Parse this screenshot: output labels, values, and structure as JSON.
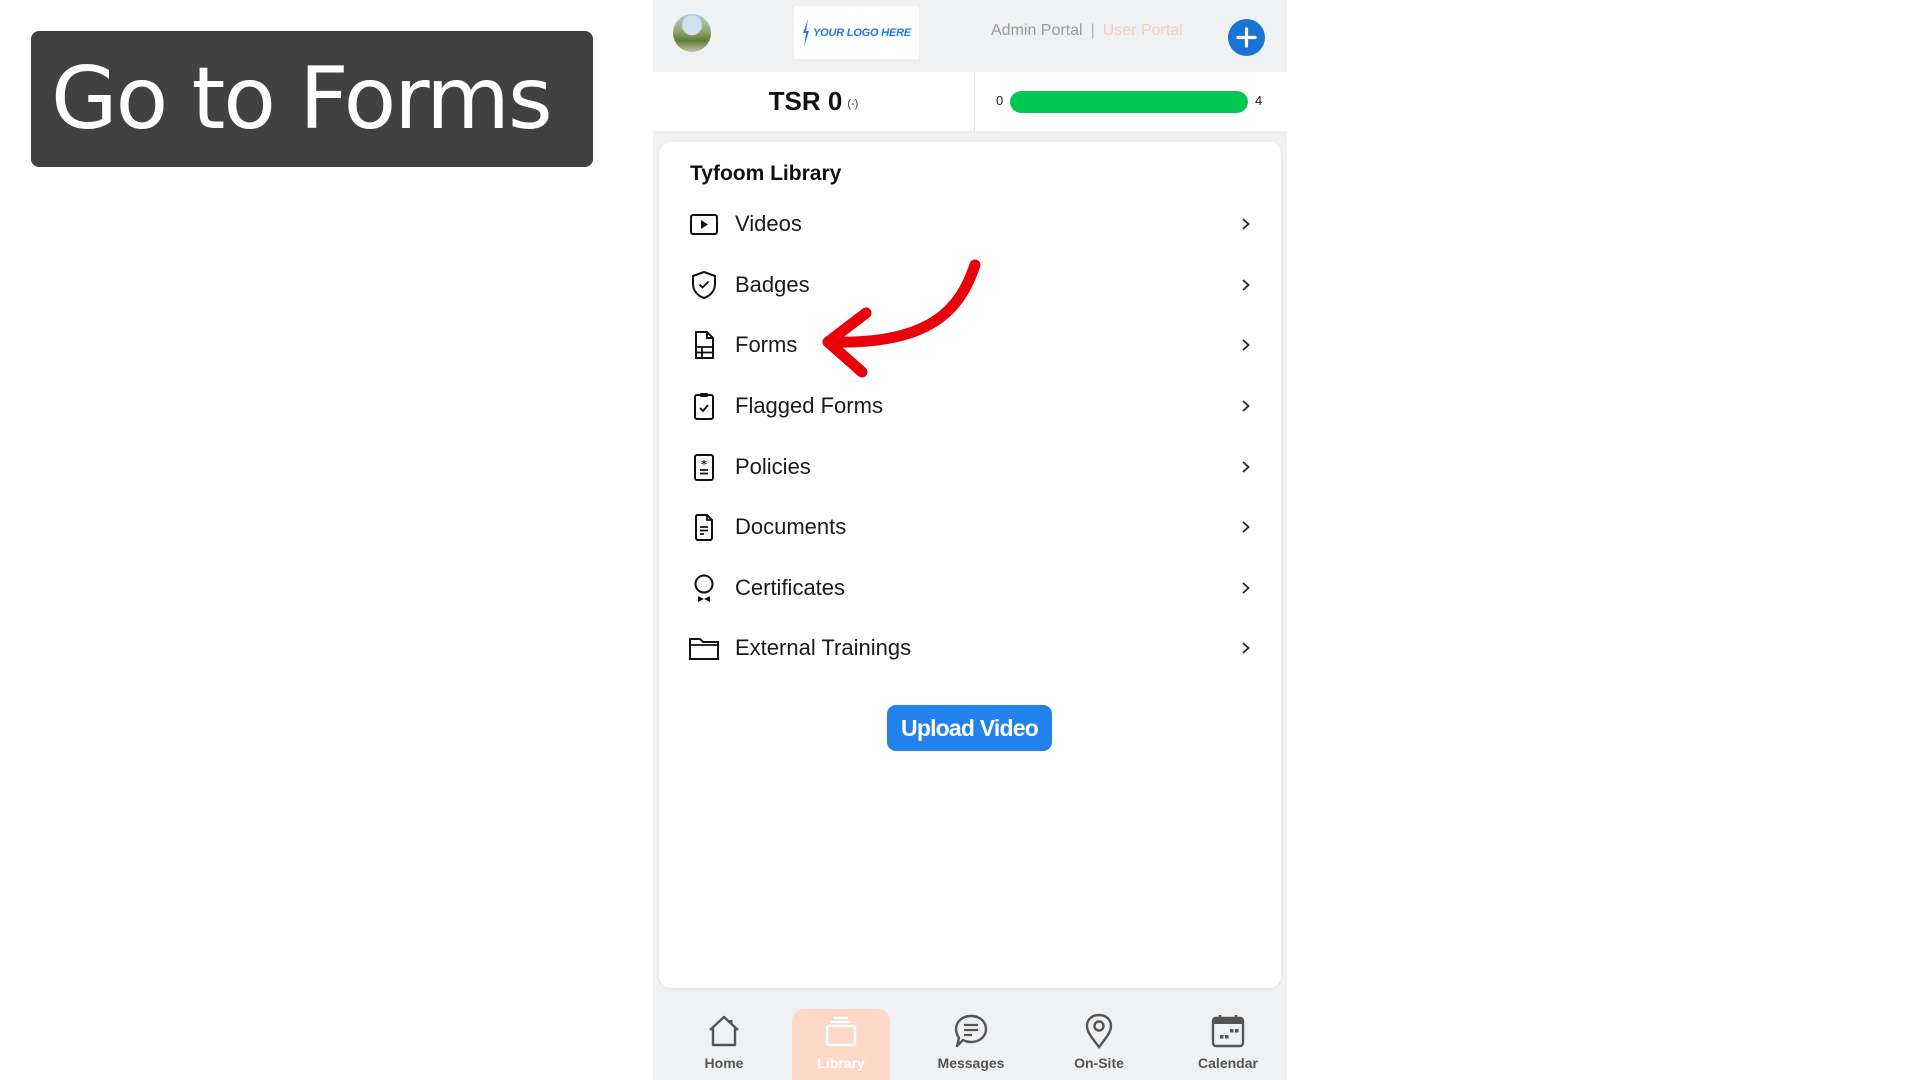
{
  "callout": {
    "text": "Go to Forms"
  },
  "header": {
    "logo_text": "YOUR LOGO HERE",
    "admin_portal": "Admin Portal",
    "separator": "|",
    "user_portal": "User Portal",
    "add_button": "+",
    "colors": {
      "add_button": "#1b73d6",
      "user_portal": "#f9cdb9"
    }
  },
  "tsr": {
    "label": "TSR 0",
    "delta": "(-)",
    "progress_min": "0",
    "progress_max": "4",
    "progress_fraction": 1.0,
    "progress_color": "#00c853"
  },
  "library": {
    "title": "Tyfoom Library",
    "items": [
      {
        "label": "Videos",
        "icon": "video-play-icon"
      },
      {
        "label": "Badges",
        "icon": "shield-check-icon"
      },
      {
        "label": "Forms",
        "icon": "form-document-icon"
      },
      {
        "label": "Flagged Forms",
        "icon": "clipboard-check-icon"
      },
      {
        "label": "Policies",
        "icon": "policy-document-icon"
      },
      {
        "label": "Documents",
        "icon": "document-icon"
      },
      {
        "label": "Certificates",
        "icon": "award-ribbon-icon"
      },
      {
        "label": "External Trainings",
        "icon": "folder-icon"
      }
    ],
    "upload_button": "Upload Video"
  },
  "annotation": {
    "arrow_color": "#e8000b",
    "points_to": "Forms"
  },
  "bottom_nav": {
    "items": [
      {
        "label": "Home",
        "icon": "home-icon",
        "active": false
      },
      {
        "label": "Library",
        "icon": "library-icon",
        "active": true
      },
      {
        "label": "Messages",
        "icon": "messages-icon",
        "active": false
      },
      {
        "label": "On-Site",
        "icon": "location-pin-icon",
        "active": false
      },
      {
        "label": "Calendar",
        "icon": "calendar-icon",
        "active": false
      }
    ],
    "active_color": "#fdd8c9"
  }
}
